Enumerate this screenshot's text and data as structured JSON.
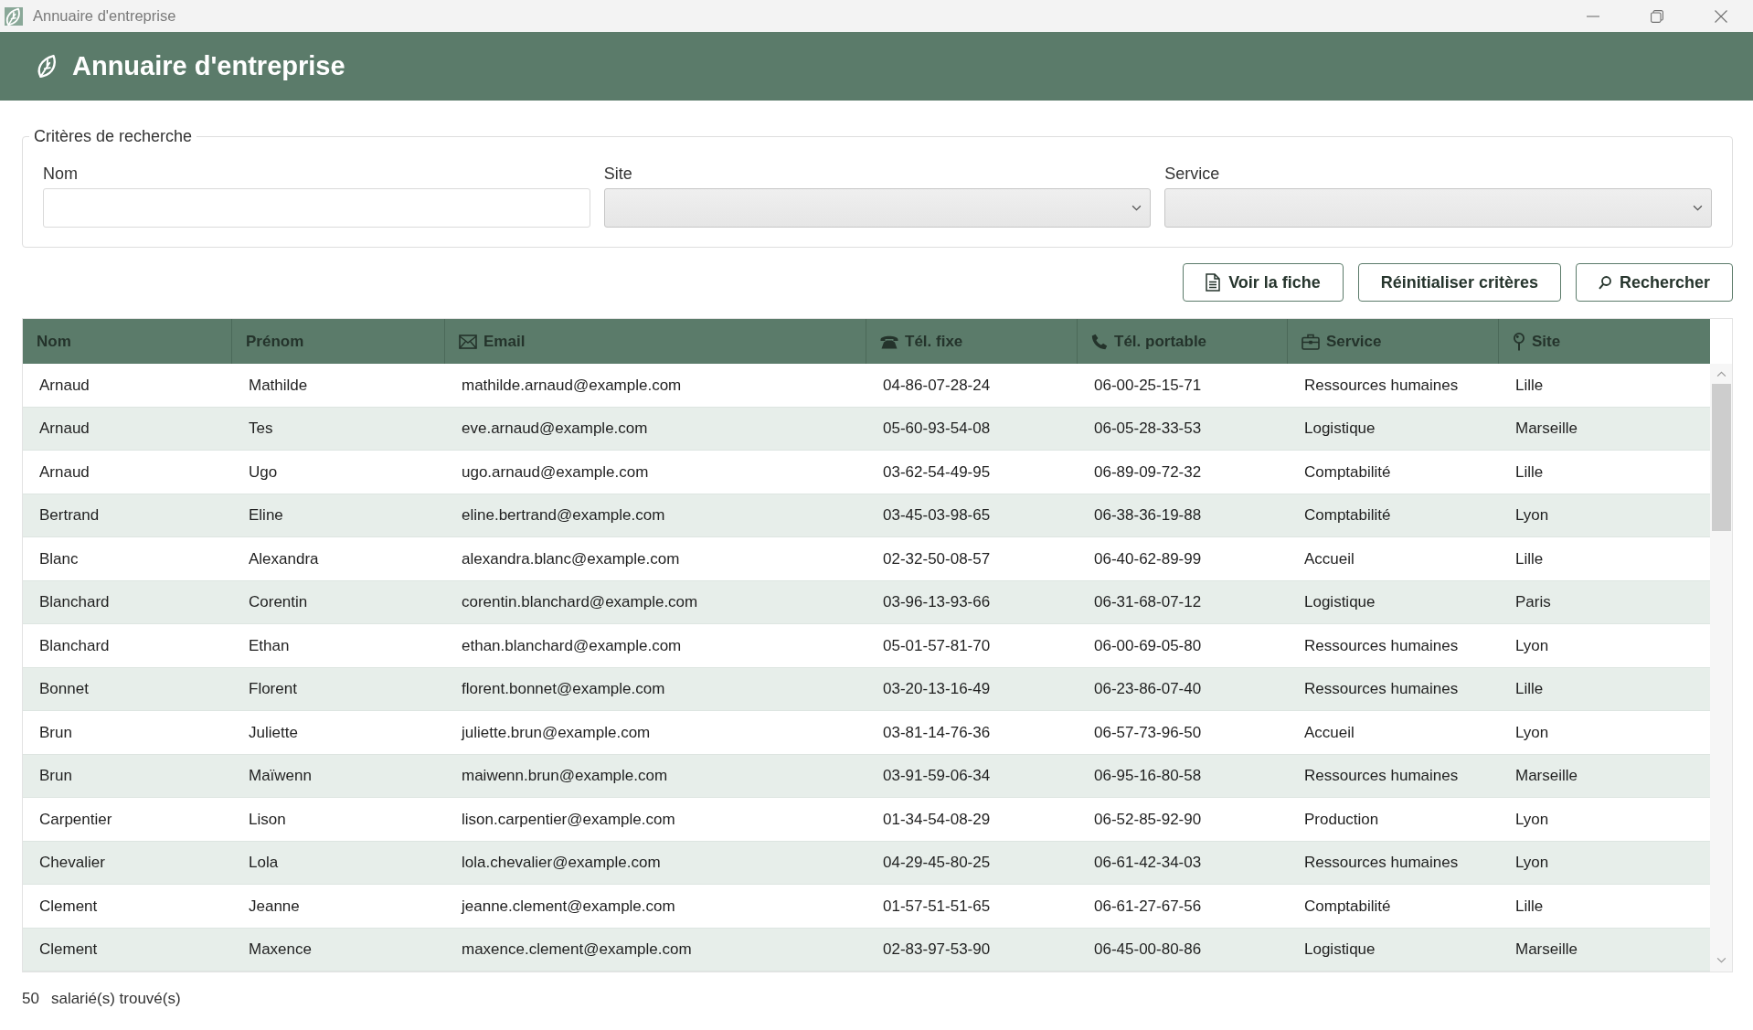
{
  "window": {
    "title": "Annuaire d'entreprise"
  },
  "header": {
    "title": "Annuaire d'entreprise"
  },
  "search_criteria": {
    "legend": "Critères de recherche",
    "fields": [
      {
        "label": "Nom",
        "kind": "text"
      },
      {
        "label": "Site",
        "kind": "dropdown"
      },
      {
        "label": "Service",
        "kind": "dropdown"
      }
    ]
  },
  "buttons": [
    "Voir la fiche",
    "Réinitialiser critères",
    "Rechercher"
  ],
  "table": {
    "columns": [
      "Nom",
      "Prénom",
      "Email",
      "Tél. fixe",
      "Tél. portable",
      "Service",
      "Site"
    ],
    "rows": [
      [
        "Arnaud",
        "Mathilde",
        "mathilde.arnaud@example.com",
        "04-86-07-28-24",
        "06-00-25-15-71",
        "Ressources humaines",
        "Lille"
      ],
      [
        "Arnaud",
        "Tes",
        "eve.arnaud@example.com",
        "05-60-93-54-08",
        "06-05-28-33-53",
        "Logistique",
        "Marseille"
      ],
      [
        "Arnaud",
        "Ugo",
        "ugo.arnaud@example.com",
        "03-62-54-49-95",
        "06-89-09-72-32",
        "Comptabilité",
        "Lille"
      ],
      [
        "Bertrand",
        "Eline",
        "eline.bertrand@example.com",
        "03-45-03-98-65",
        "06-38-36-19-88",
        "Comptabilité",
        "Lyon"
      ],
      [
        "Blanc",
        "Alexandra",
        "alexandra.blanc@example.com",
        "02-32-50-08-57",
        "06-40-62-89-99",
        "Accueil",
        "Lille"
      ],
      [
        "Blanchard",
        "Corentin",
        "corentin.blanchard@example.com",
        "03-96-13-93-66",
        "06-31-68-07-12",
        "Logistique",
        "Paris"
      ],
      [
        "Blanchard",
        "Ethan",
        "ethan.blanchard@example.com",
        "05-01-57-81-70",
        "06-00-69-05-80",
        "Ressources humaines",
        "Lyon"
      ],
      [
        "Bonnet",
        "Florent",
        "florent.bonnet@example.com",
        "03-20-13-16-49",
        "06-23-86-07-40",
        "Ressources humaines",
        "Lille"
      ],
      [
        "Brun",
        "Juliette",
        "juliette.brun@example.com",
        "03-81-14-76-36",
        "06-57-73-96-50",
        "Accueil",
        "Lyon"
      ],
      [
        "Brun",
        "Maïwenn",
        "maiwenn.brun@example.com",
        "03-91-59-06-34",
        "06-95-16-80-58",
        "Ressources humaines",
        "Marseille"
      ],
      [
        "Carpentier",
        "Lison",
        "lison.carpentier@example.com",
        "01-34-54-08-29",
        "06-52-85-92-90",
        "Production",
        "Lyon"
      ],
      [
        "Chevalier",
        "Lola",
        "lola.chevalier@example.com",
        "04-29-45-80-25",
        "06-61-42-34-03",
        "Ressources humaines",
        "Lyon"
      ],
      [
        "Clement",
        "Jeanne",
        "jeanne.clement@example.com",
        "01-57-51-51-65",
        "06-61-27-67-56",
        "Comptabilité",
        "Lille"
      ],
      [
        "Clement",
        "Maxence",
        "maxence.clement@example.com",
        "02-83-97-53-90",
        "06-45-00-80-86",
        "Logistique",
        "Marseille"
      ]
    ]
  },
  "status_bar": {
    "count": "50",
    "label": "salarié(s) trouvé(s)"
  }
}
